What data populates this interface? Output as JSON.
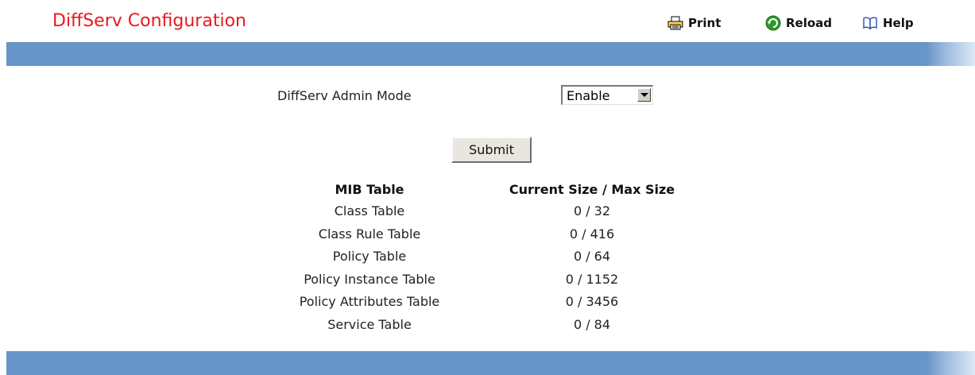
{
  "header": {
    "title": "DiffServ Configuration",
    "print_label": "Print",
    "reload_label": "Reload",
    "help_label": "Help"
  },
  "form": {
    "admin_mode_label": "DiffServ Admin Mode",
    "admin_mode_value": "Enable",
    "submit_label": "Submit"
  },
  "table": {
    "headers": [
      "MIB Table",
      "Current Size / Max Size"
    ],
    "rows": [
      {
        "name": "Class Table",
        "size": "0 / 32"
      },
      {
        "name": "Class Rule Table",
        "size": "0 / 416"
      },
      {
        "name": "Policy Table",
        "size": "0 / 64"
      },
      {
        "name": "Policy Instance Table",
        "size": "0 / 1152"
      },
      {
        "name": "Policy Attributes Table",
        "size": "0 / 3456"
      },
      {
        "name": "Service Table",
        "size": "0 / 84"
      }
    ]
  },
  "colors": {
    "title": "#e8191e",
    "bar": "#6996c9"
  },
  "icons": [
    "printer-icon",
    "reload-icon",
    "help-book-icon"
  ]
}
